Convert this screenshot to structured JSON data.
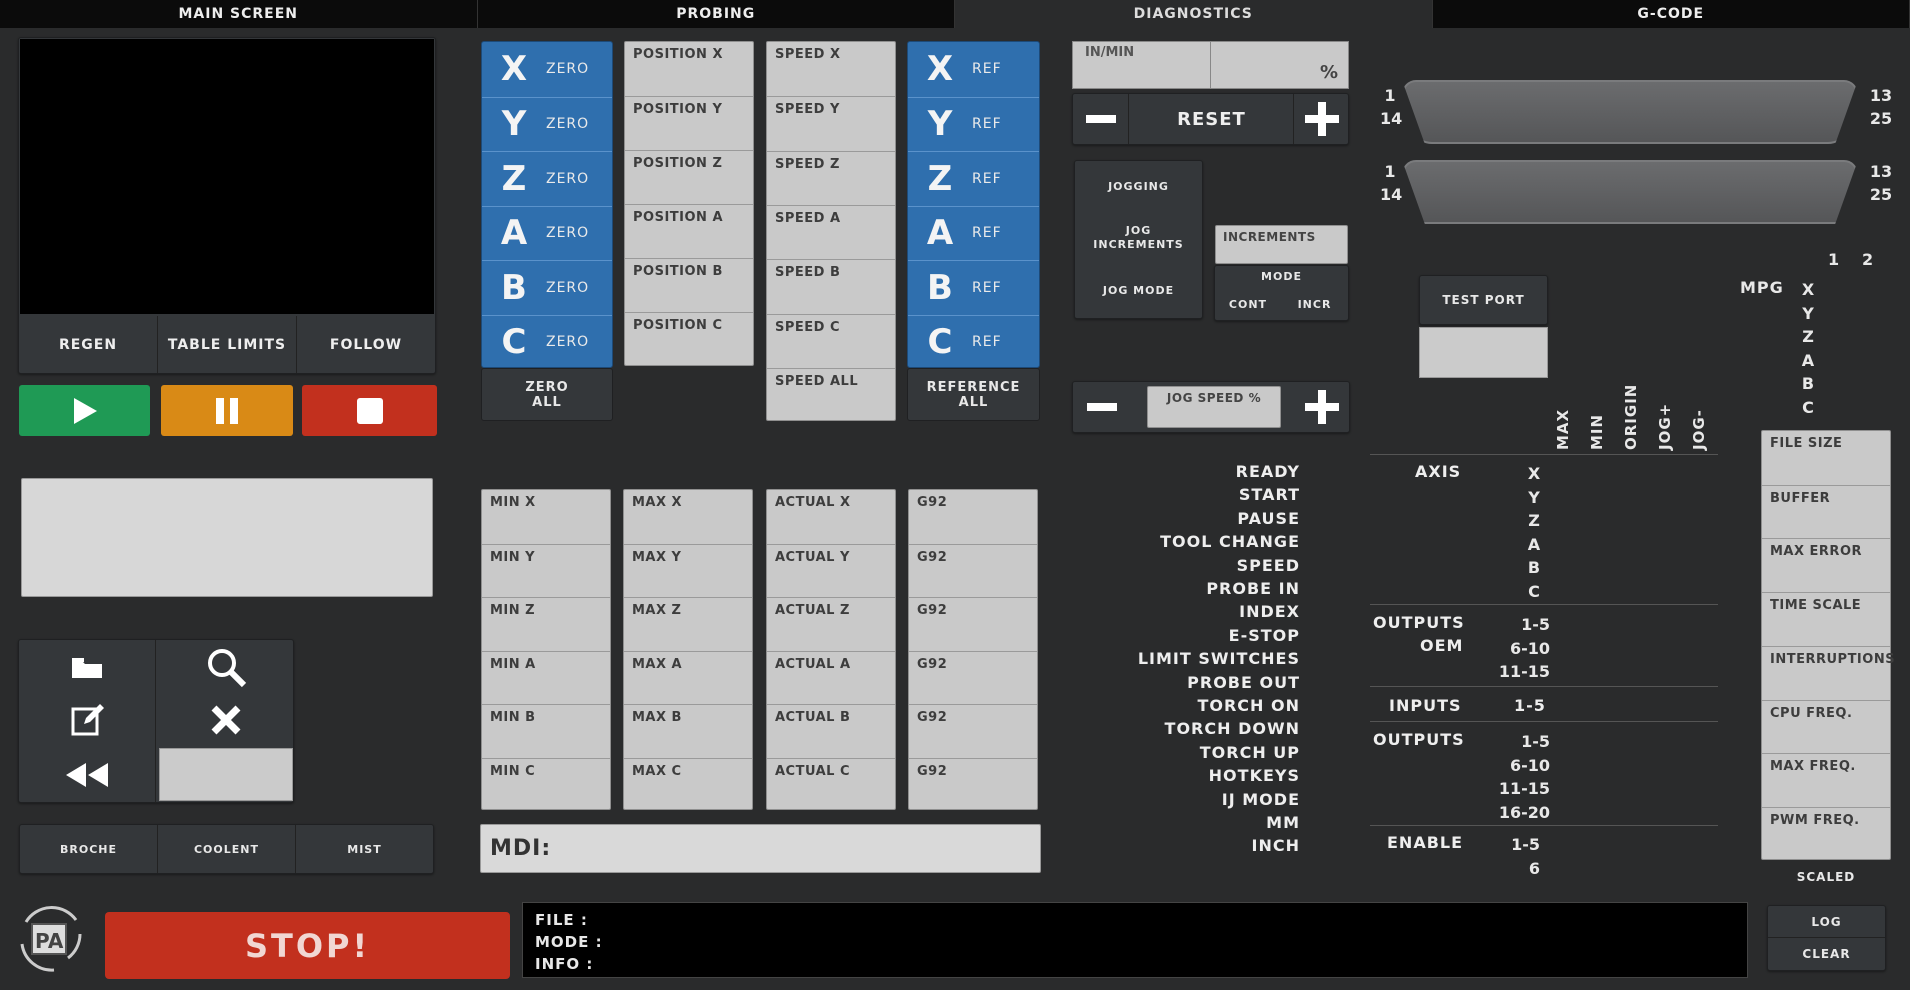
{
  "tabs": [
    "MAIN SCREEN",
    "PROBING",
    "DIAGNOSTICS",
    "G-CODE"
  ],
  "view_buttons": [
    "REGEN",
    "TABLE LIMITS",
    "FOLLOW"
  ],
  "axes": [
    "X",
    "Y",
    "Z",
    "A",
    "B",
    "C"
  ],
  "zero_label": "ZERO",
  "zero_all": "ZERO\nALL",
  "ref_label": "REF",
  "reference_all": "REFERENCE\nALL",
  "positions": [
    "POSITION X",
    "POSITION Y",
    "POSITION Z",
    "POSITION A",
    "POSITION B",
    "POSITION C"
  ],
  "speeds": [
    "SPEED X",
    "SPEED Y",
    "SPEED Z",
    "SPEED A",
    "SPEED B",
    "SPEED C",
    "SPEED ALL"
  ],
  "mins": [
    "MIN X",
    "MIN Y",
    "MIN Z",
    "MIN A",
    "MIN B",
    "MIN C"
  ],
  "maxs": [
    "MAX X",
    "MAX Y",
    "MAX Z",
    "MAX A",
    "MAX B",
    "MAX C"
  ],
  "actuals": [
    "ACTUAL X",
    "ACTUAL Y",
    "ACTUAL Z",
    "ACTUAL A",
    "ACTUAL B",
    "ACTUAL C"
  ],
  "g92": [
    "G92",
    "G92",
    "G92",
    "G92",
    "G92",
    "G92"
  ],
  "mdi_label": "MDI:",
  "feed": {
    "unit": "IN/MIN",
    "percent": "%",
    "reset": "RESET",
    "minus": "—",
    "plus": "+"
  },
  "jog": {
    "jogging": "JOGGING",
    "increments_btn": "JOG\nINCREMENTS",
    "mode_btn": "JOG MODE",
    "increments": "INCREMENTS",
    "mode": "MODE",
    "cont": "CONT",
    "incr": "INCR",
    "speed": "JOG SPEED %"
  },
  "coolant": [
    "BROCHE",
    "COOLENT",
    "MIST"
  ],
  "stop": "STOP!",
  "status": {
    "file": "FILE   :",
    "mode": "MODE  :",
    "info": "INFO   :"
  },
  "log": "LOG",
  "clear": "CLEAR",
  "port_pins": {
    "left_top": "1",
    "left_bottom": "14",
    "right_top": "13",
    "right_bottom": "25"
  },
  "test_port": "TEST PORT",
  "mpg": {
    "label": "MPG",
    "col1": "1",
    "col2": "2",
    "axes": [
      "X",
      "Y",
      "Z",
      "A",
      "B",
      "C"
    ]
  },
  "signals": [
    "READY",
    "START",
    "PAUSE",
    "TOOL CHANGE",
    "SPEED",
    "PROBE IN",
    "INDEX",
    "E-STOP",
    "LIMIT SWITCHES",
    "PROBE OUT",
    "TORCH ON",
    "TORCH DOWN",
    "TORCH UP",
    "HOTKEYS",
    "IJ MODE",
    "MM",
    "INCH"
  ],
  "col_headers": [
    "MAX",
    "MIN",
    "ORIGIN",
    "JOG+",
    "JOG-"
  ],
  "axis_label": "AXIS",
  "axis_letters": [
    "X",
    "Y",
    "Z",
    "A",
    "B",
    "C"
  ],
  "outputs_oem": {
    "l1": "OUTPUTS",
    "l2": "OEM",
    "ranges": [
      "1-5",
      "6-10",
      "11-15"
    ]
  },
  "inputs": {
    "label": "INPUTS",
    "range": "1-5"
  },
  "outputs": {
    "label": "OUTPUTS",
    "ranges": [
      "1-5",
      "6-10",
      "11-15",
      "16-20"
    ]
  },
  "enable": {
    "label": "ENABLE",
    "ranges": [
      "1-5",
      "6"
    ]
  },
  "stats": [
    "FILE SIZE",
    "BUFFER",
    "MAX ERROR",
    "TIME SCALE",
    "INTERRUPTIONS",
    "CPU FREQ.",
    "MAX FREQ.",
    "PWM FREQ."
  ],
  "scaled": "SCALED",
  "colors": {
    "blue": "#2f6fae",
    "green": "#1f9a55",
    "orange": "#d98a16",
    "red": "#c2301e"
  }
}
